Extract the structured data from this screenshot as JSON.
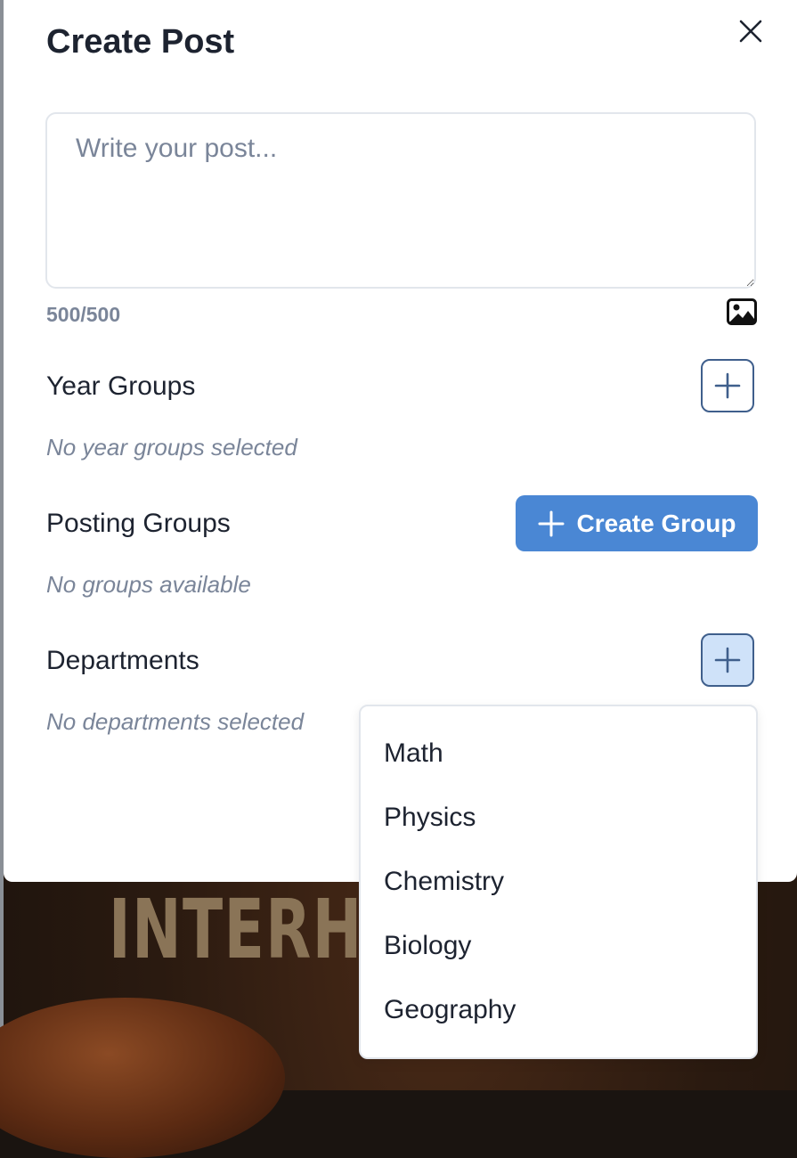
{
  "modal": {
    "title": "Create Post",
    "post_placeholder": "Write your post...",
    "char_count": "500/500"
  },
  "year_groups": {
    "label": "Year Groups",
    "empty_text": "No year groups selected"
  },
  "posting_groups": {
    "label": "Posting Groups",
    "create_button_label": "Create Group",
    "empty_text": "No groups available"
  },
  "departments": {
    "label": "Departments",
    "empty_text": "No departments selected",
    "options": [
      "Math",
      "Physics",
      "Chemistry",
      "Biology",
      "Geography"
    ]
  },
  "background": {
    "poster_text": "INTERH"
  },
  "colors": {
    "primary": "#4a87d4",
    "outline_button": "#3f5f8c",
    "active_button_bg": "#cfe2f9",
    "muted_text": "#7a8599",
    "heading_text": "#1d2330"
  },
  "icons": {
    "close": "close-icon",
    "image": "image-icon",
    "plus": "plus-icon"
  }
}
